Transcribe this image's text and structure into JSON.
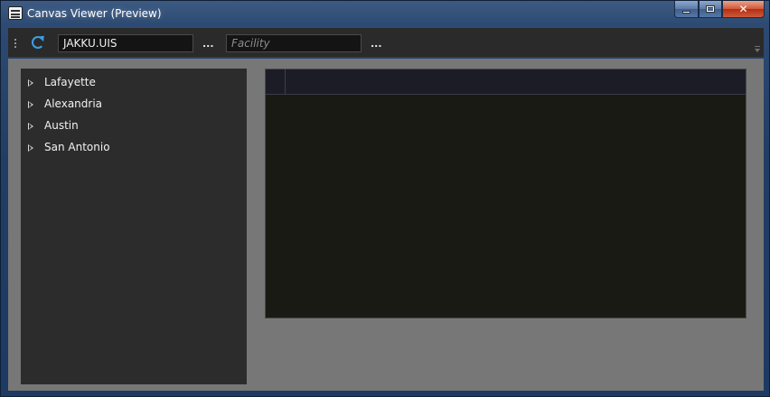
{
  "window": {
    "title": "Canvas Viewer (Preview)",
    "minimize_label": "",
    "maximize_label": "",
    "close_label": "✕"
  },
  "toolbar": {
    "server_value": "JAKKU.UIS",
    "server_browse_label": "...",
    "facility_value": "",
    "facility_placeholder": "Facility",
    "facility_browse_label": "..."
  },
  "tree": {
    "items": [
      {
        "label": "Lafayette"
      },
      {
        "label": "Alexandria"
      },
      {
        "label": "Austin"
      },
      {
        "label": "San Antonio"
      }
    ]
  },
  "colors": {
    "accent": "#3c9ee6",
    "client_background": "#777777",
    "panel_background": "#2c2c2c",
    "canvas_background": "#1a1a14"
  }
}
